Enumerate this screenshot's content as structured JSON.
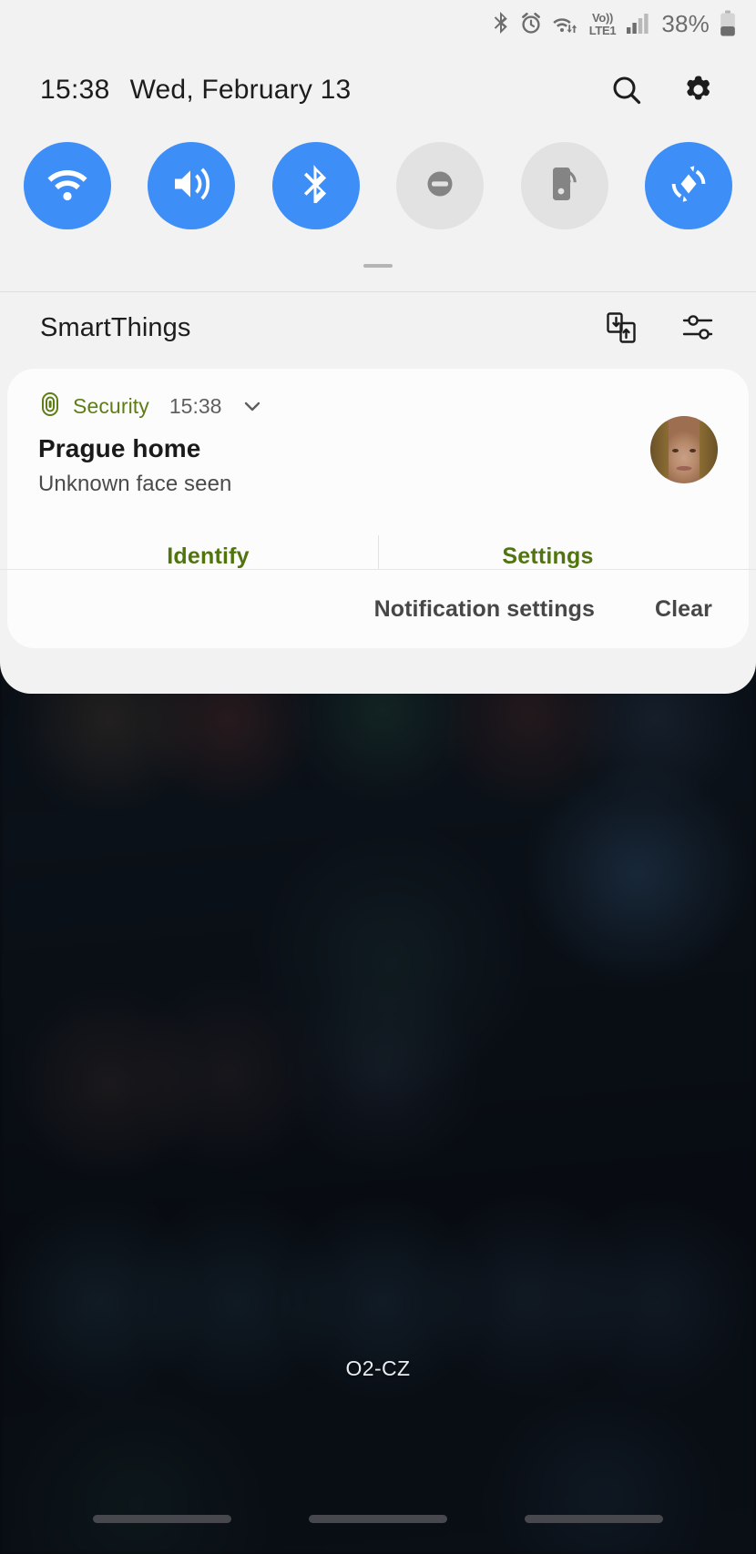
{
  "status_bar": {
    "icons": [
      "bluetooth-icon",
      "alarm-icon",
      "wifi-transfer-icon",
      "volte-icon",
      "signal-bars-icon"
    ],
    "volte_label_top": "Vo))",
    "volte_label_bottom": "LTE1",
    "battery_percent": "38%"
  },
  "header": {
    "time": "15:38",
    "date": "Wed, February 13",
    "search_icon": "search-icon",
    "settings_icon": "gear-icon"
  },
  "quick_toggles": [
    {
      "name": "wifi",
      "icon": "wifi-icon",
      "state": "on",
      "color": "#3d8ef7"
    },
    {
      "name": "sound",
      "icon": "sound-icon",
      "state": "on",
      "color": "#3d8ef7"
    },
    {
      "name": "bluetooth",
      "icon": "bluetooth-icon",
      "state": "on",
      "color": "#3d8ef7"
    },
    {
      "name": "do-not-disturb",
      "icon": "dnd-icon",
      "state": "off",
      "color": "#e2e2e2"
    },
    {
      "name": "mobile-hotspot",
      "icon": "hotspot-icon",
      "state": "off",
      "color": "#e2e2e2"
    },
    {
      "name": "auto-rotate",
      "icon": "auto-rotate-icon",
      "state": "on",
      "color": "#3d8ef7"
    }
  ],
  "smartthings": {
    "title": "SmartThings",
    "transfer_icon": "device-transfer-icon",
    "controls_icon": "sliders-icon"
  },
  "notification": {
    "app_name": "Security",
    "app_icon": "fingerprint-icon",
    "time": "15:38",
    "expand_icon": "chevron-down-icon",
    "title": "Prague home",
    "text": "Unknown face seen",
    "avatar": "face-thumbnail",
    "accent_color": "#5f7d16",
    "actions": [
      {
        "label": "Identify"
      },
      {
        "label": "Settings"
      }
    ]
  },
  "shade_footer": {
    "notification_settings_label": "Notification settings",
    "clear_label": "Clear"
  },
  "home_screen": {
    "carrier": "O2-CZ"
  }
}
